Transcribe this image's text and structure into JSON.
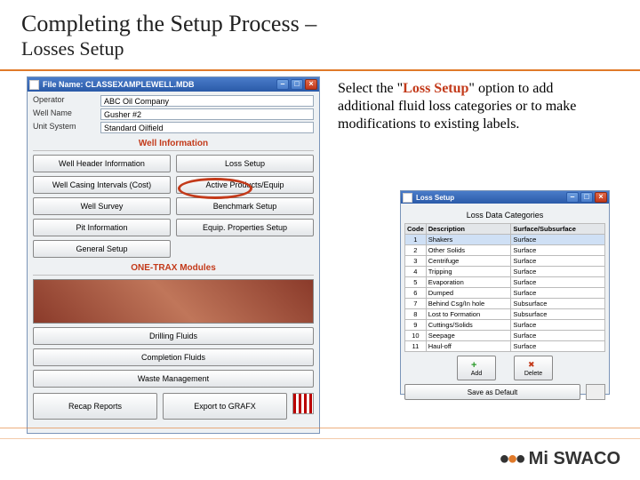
{
  "slide": {
    "title_main": "Completing the Setup Process –",
    "title_sub": "Losses Setup"
  },
  "instruction": {
    "pre": "Select the \"",
    "emph": "Loss Setup",
    "post": "\" option to add additional fluid loss categories or to make modifications to existing labels."
  },
  "app": {
    "title": "File Name: CLASSEXAMPLEWELL.MDB",
    "fields": {
      "operator_k": "Operator",
      "operator_v": "ABC Oil Company",
      "wellname_k": "Well Name",
      "wellname_v": "Gusher #2",
      "unitsys_k": "Unit System",
      "unitsys_v": "Standard Oilfield"
    },
    "section_well": "Well Information",
    "buttons": {
      "header": "Well Header Information",
      "loss": "Loss Setup",
      "casing": "Well Casing Intervals (Cost)",
      "active": "Active Products/Equip",
      "survey": "Well Survey",
      "bench": "Benchmark Setup",
      "pit": "Pit Information",
      "equip": "Equip. Properties Setup",
      "general": "General Setup"
    },
    "section_mods": "ONE-TRAX Modules",
    "modules": {
      "drill": "Drilling Fluids",
      "comp": "Completion Fluids",
      "waste": "Waste Management"
    },
    "bottom": {
      "recap": "Recap Reports",
      "grafx": "Export to GRAFX"
    }
  },
  "loss_win": {
    "title": "Loss Setup",
    "grid_title": "Loss Data Categories",
    "headers": {
      "code": "Code",
      "desc": "Description",
      "surf": "Surface/Subsurface"
    },
    "rows": [
      {
        "c": "1",
        "d": "Shakers",
        "s": "Surface"
      },
      {
        "c": "2",
        "d": "Other Solids",
        "s": "Surface"
      },
      {
        "c": "3",
        "d": "Centrifuge",
        "s": "Surface"
      },
      {
        "c": "4",
        "d": "Tripping",
        "s": "Surface"
      },
      {
        "c": "5",
        "d": "Evaporation",
        "s": "Surface"
      },
      {
        "c": "6",
        "d": "Dumped",
        "s": "Surface"
      },
      {
        "c": "7",
        "d": "Behind Csg/In hole",
        "s": "Subsurface"
      },
      {
        "c": "8",
        "d": "Lost to Formation",
        "s": "Subsurface"
      },
      {
        "c": "9",
        "d": "Cuttings/Solids",
        "s": "Surface"
      },
      {
        "c": "10",
        "d": "Seepage",
        "s": "Surface"
      },
      {
        "c": "11",
        "d": "Haul-off",
        "s": "Surface"
      }
    ],
    "add": "Add",
    "delete": "Delete",
    "save": "Save as Default"
  },
  "brand": {
    "mi": "Mi",
    "swaco": "SWACO"
  }
}
